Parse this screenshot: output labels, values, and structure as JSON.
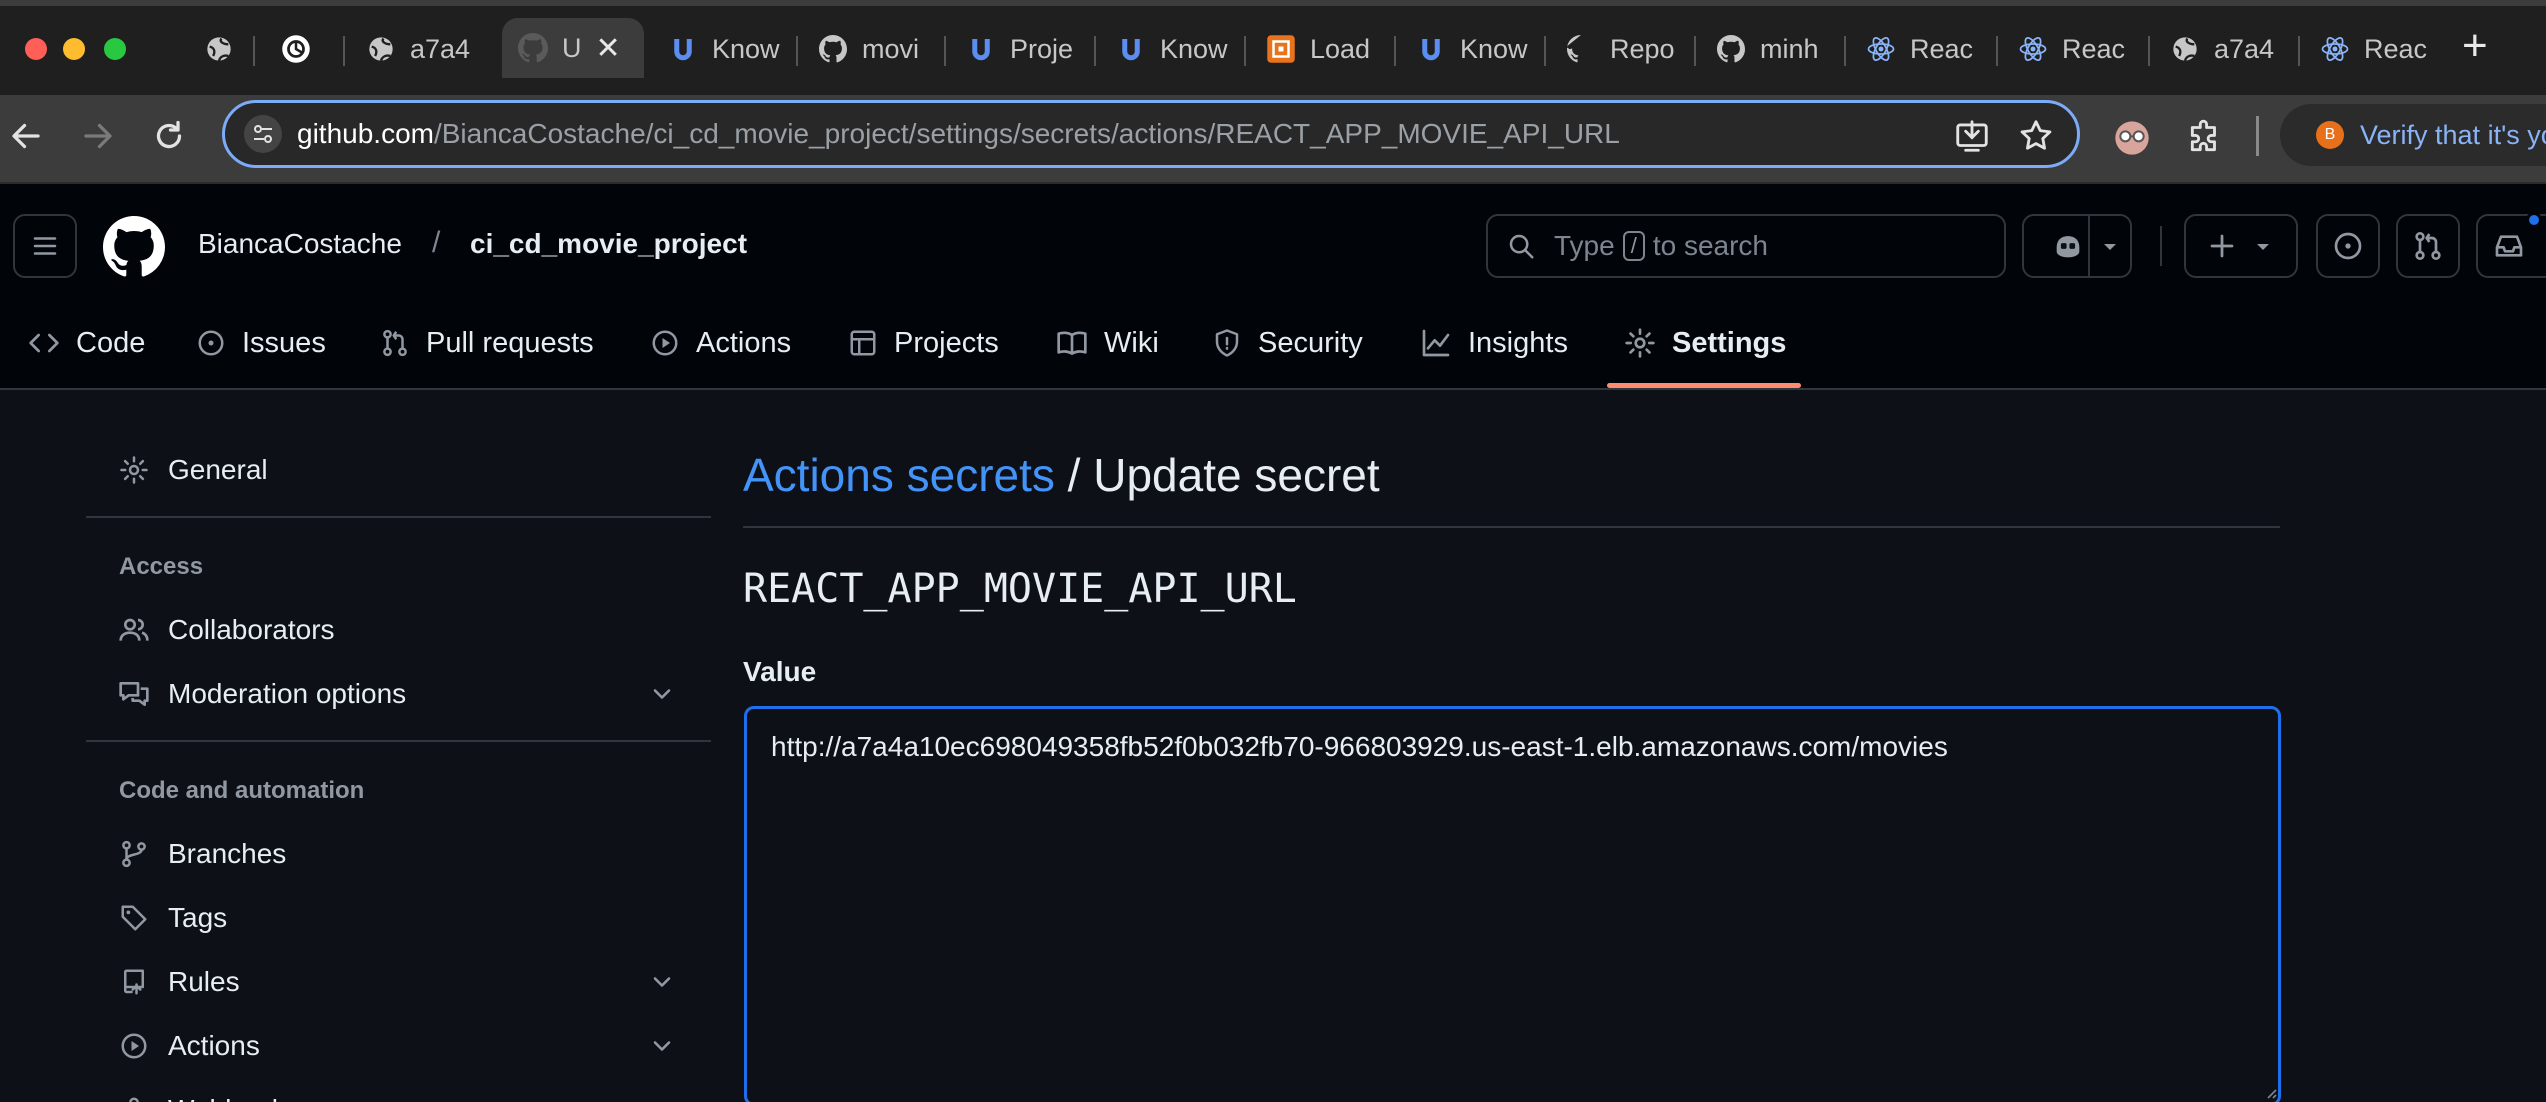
{
  "browser": {
    "tabs": [
      {
        "label": "",
        "icon": "globe-icon"
      },
      {
        "label": "",
        "icon": "openai-icon"
      },
      {
        "label": "a7a4",
        "icon": "globe-icon"
      },
      {
        "label": "U",
        "icon": "github-icon",
        "active": true
      },
      {
        "label": "Know",
        "icon": "udemy-icon"
      },
      {
        "label": "movi",
        "icon": "github-icon"
      },
      {
        "label": "Proje",
        "icon": "udemy-icon"
      },
      {
        "label": "Know",
        "icon": "udemy-icon"
      },
      {
        "label": "Load",
        "icon": "aws-icon"
      },
      {
        "label": "Know",
        "icon": "udemy-icon"
      },
      {
        "label": "Repo",
        "icon": "github-icon"
      },
      {
        "label": "minh",
        "icon": "github-icon"
      },
      {
        "label": "Reac",
        "icon": "react-icon"
      },
      {
        "label": "Reac",
        "icon": "react-icon"
      },
      {
        "label": "a7a4",
        "icon": "globe-icon"
      },
      {
        "label": "Reac",
        "icon": "react-icon"
      }
    ],
    "url_host": "github.com",
    "url_path": "/BiancaCostache/ci_cd_movie_project/settings/secrets/actions/REACT_APP_MOVIE_API_URL",
    "verify_text": "Verify that it's yo",
    "verify_badge": "B"
  },
  "header": {
    "owner": "BiancaCostache",
    "separator": "/",
    "repo": "ci_cd_movie_project",
    "search_prefix": "Type",
    "search_key": "/",
    "search_suffix": "to search"
  },
  "repo_nav": [
    {
      "label": "Code",
      "icon": "code-icon"
    },
    {
      "label": "Issues",
      "icon": "issue-icon"
    },
    {
      "label": "Pull requests",
      "icon": "pull-request-icon"
    },
    {
      "label": "Actions",
      "icon": "play-icon"
    },
    {
      "label": "Projects",
      "icon": "table-icon"
    },
    {
      "label": "Wiki",
      "icon": "book-icon"
    },
    {
      "label": "Security",
      "icon": "shield-icon"
    },
    {
      "label": "Insights",
      "icon": "graph-icon"
    },
    {
      "label": "Settings",
      "icon": "gear-icon",
      "selected": true
    }
  ],
  "sidebar": {
    "general": "General",
    "access_heading": "Access",
    "collaborators": "Collaborators",
    "moderation": "Moderation options",
    "code_heading": "Code and automation",
    "branches": "Branches",
    "tags": "Tags",
    "rules": "Rules",
    "actions": "Actions",
    "webhooks": "Webhooks"
  },
  "main": {
    "title_link": "Actions secrets",
    "title_rest": " / Update secret",
    "secret_name": "REACT_APP_MOVIE_API_URL",
    "value_label": "Value",
    "value": "http://a7a4a10ec698049358fb52f0b032fb70-966803929.us-east-1.elb.amazonaws.com/movies"
  },
  "colors": {
    "accent": "#4493f8",
    "selected_underline": "#fd8c73",
    "focus_border": "#1f6feb",
    "background": "#0d1117"
  }
}
